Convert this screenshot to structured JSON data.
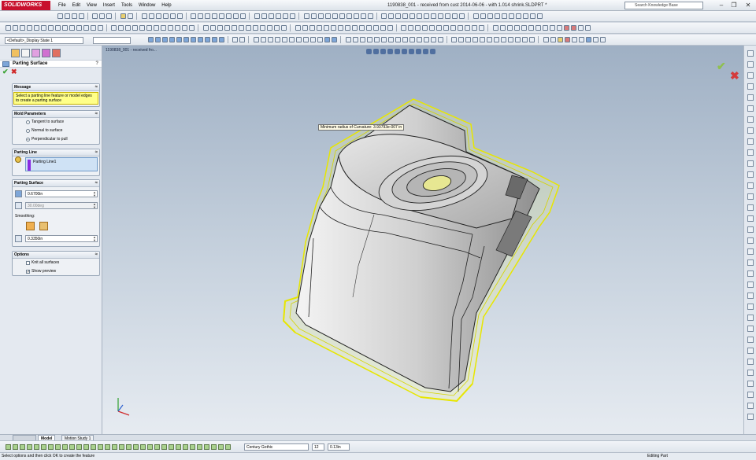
{
  "app": {
    "brand": "SOLIDWORKS",
    "doc_title": "1190838_001 - received from cust 2014-06-06 - with 1.014 shrink.SLDPRT *"
  },
  "menu": [
    "File",
    "Edit",
    "View",
    "Insert",
    "Tools",
    "Window",
    "Help"
  ],
  "search": {
    "placeholder": "Search Knowledge Base"
  },
  "toolbar": {
    "config_select": "<Default>_Display State 1"
  },
  "viewport": {
    "tree_label": "1190838_001 - received fro...",
    "tooltip": "Minimum radius of Curvature: 3.93793e-007 in"
  },
  "panel": {
    "title": "Parting Surface",
    "help": "?",
    "ok": "✔",
    "cancel": "✖",
    "message": {
      "header": "Message",
      "text": "Select a parting line feature or model edges to create a parting surface"
    },
    "mold_parameters": {
      "header": "Mold Parameters",
      "options": [
        {
          "label": "Tangent to surface",
          "selected": false
        },
        {
          "label": "Normal to surface",
          "selected": false
        },
        {
          "label": "Perpendicular to pull",
          "selected": true
        }
      ]
    },
    "parting_line": {
      "header": "Parting Line",
      "item": "Parting Line1"
    },
    "parting_surface": {
      "header": "Parting Surface",
      "distance": "0.6700in",
      "angle": "30.00deg",
      "smoothing_label": "Smoothing:",
      "smoothing_distance": "0.3350in"
    },
    "options": {
      "header": "Options",
      "knit": {
        "label": "Knit all surfaces",
        "checked": false
      },
      "preview": {
        "label": "Show preview",
        "checked": true
      }
    }
  },
  "bottom_tabs": [
    {
      "label": "Model",
      "active": true
    },
    {
      "label": "Motion Study 1",
      "active": false
    }
  ],
  "bottom_toolbar": {
    "font": "Century Gothic",
    "font_size": "12",
    "height": "0.13in"
  },
  "status": {
    "left": "Select options and then click OK to create the feature",
    "right": "Editing Part"
  },
  "colors": {
    "accent": "#c8102e",
    "highlight": "#ffff00",
    "message_bg": "#ffff88"
  }
}
